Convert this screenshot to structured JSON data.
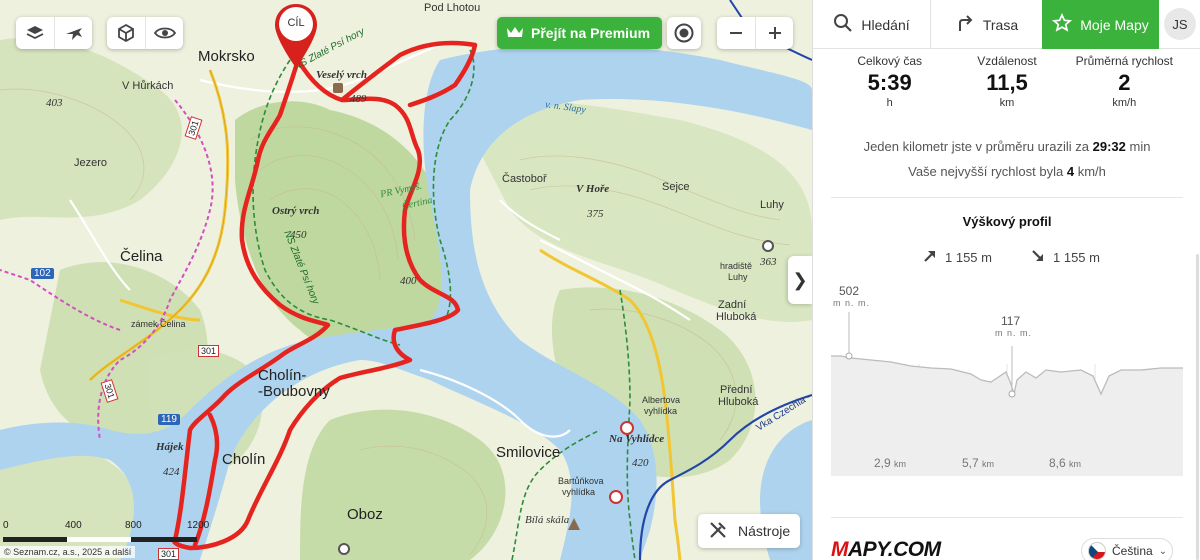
{
  "map": {
    "premium_label": "Přejít na Premium",
    "pin_label": "CÍL",
    "tools_label": "Nástroje",
    "collapse_glyph": "❯",
    "attribution": "Seznam.cz, a.s., 2025 a další",
    "scale": [
      "0",
      "400",
      "800",
      "1200"
    ],
    "buttons": [
      "layers-icon",
      "airplane-icon",
      "cube-icon",
      "eye-icon",
      "location-target-icon",
      "zoom-out-icon",
      "zoom-in-icon"
    ],
    "labels": {
      "mokrsko": "Mokrsko",
      "v_hurkach": "V Hůrkách",
      "jezero": "Jezero",
      "celina": "Čelina",
      "zamek": "zámek Čelina",
      "cholin_boubovny_1": "Cholín-",
      "cholin_boubovny_2": "-Boubovny",
      "cholin": "Cholín",
      "hajek": "Hájek",
      "hajek_elev": "424",
      "oboz": "Oboz",
      "smilovice": "Smilovice",
      "vesely_vrch": "Veselý vrch",
      "vesely_elev": "489",
      "ostry_vrch": "Ostrý vrch",
      "ostry_elev": "450",
      "elev_400": "400",
      "elev_403": "403",
      "pod_lhotou": "Pod Lhotou",
      "slapy": "v. n. Slapy",
      "castobor": "Častoboř",
      "v_hore": "V Hoře",
      "v_hore_elev": "375",
      "sejce": "Sejce",
      "luhy": "Luhy",
      "hradiste_1": "hradiště",
      "hradiste_2": "Luhy",
      "elev_363": "363",
      "zadni_1": "Zadní",
      "zadni_2": "Hluboká",
      "predni_1": "Přední",
      "predni_2": "Hluboká",
      "albertova_1": "Albertova",
      "albertova_2": "vyhlídka",
      "na_vyhlidce": "Na Vyhlídce",
      "elev_420": "420",
      "bartunkova_1": "Bartůňkova",
      "bartunkova_2": "vyhlídka",
      "bila_skala": "Bílá skála",
      "reserve_1": "PR Vymyš.",
      "reserve_2": "Čertina",
      "ns_trail_1": "NS Zlaté Psí hory",
      "ns_trail_2": "NS Zlaté Psí hory",
      "road_102": "102",
      "road_119": "119",
      "road_301a": "301",
      "road_301b": "301",
      "road_301c": "301",
      "road_301d": "301",
      "vka": "Vka Czechia - s"
    }
  },
  "panel": {
    "tabs": {
      "search": "Hledání",
      "route": "Trasa",
      "my_maps": "Moje Mapy"
    },
    "avatar": "JS",
    "stats": [
      {
        "title": "Celkový čas",
        "value": "5:39",
        "unit": "h"
      },
      {
        "title": "Vzdálenost",
        "value": "11,5",
        "unit": "km"
      },
      {
        "title": "Průměrná rychlost",
        "value": "2",
        "unit": "km/h"
      }
    ],
    "pace": {
      "prefix": "Jeden kilometr jste v průměru urazili za",
      "value": "29:32",
      "suffix": "min"
    },
    "maxspeed": {
      "prefix": "Vaše nejvyšší rychlost byla",
      "value": "4",
      "suffix": "km/h"
    },
    "profile": {
      "title": "Výškový profil",
      "ascent": "1 155 m",
      "descent": "1 155 m",
      "max_label": "502",
      "max_unit": "m n. m.",
      "min_label": "117",
      "min_unit": "m n. m.",
      "x_ticks": [
        {
          "value": "2,9",
          "unit": "km"
        },
        {
          "value": "5,7",
          "unit": "km"
        },
        {
          "value": "8,6",
          "unit": "km"
        }
      ]
    },
    "logo_part1": "M",
    "logo_part2": "APY.COM",
    "language": "Čeština"
  }
}
